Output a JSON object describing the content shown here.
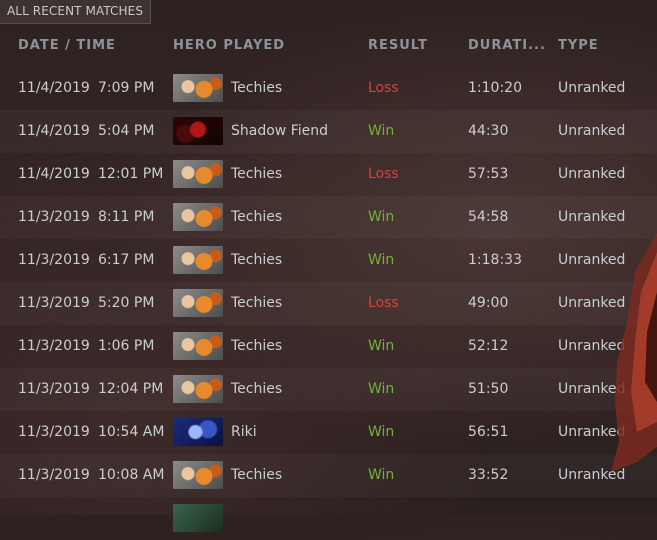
{
  "panel": {
    "title": "ALL RECENT MATCHES"
  },
  "columns": {
    "date_time": "DATE / TIME",
    "hero": "HERO PLAYED",
    "result": "RESULT",
    "duration": "DURATI...",
    "type": "TYPE"
  },
  "matches": [
    {
      "date": "11/4/2019",
      "time": "7:09 PM",
      "hero": "Techies",
      "hero_icon": "techies-portrait",
      "result": "Loss",
      "duration": "1:10:20",
      "type": "Unranked"
    },
    {
      "date": "11/4/2019",
      "time": "5:04 PM",
      "hero": "Shadow Fiend",
      "hero_icon": "shadow-fiend-portrait",
      "result": "Win",
      "duration": "44:30",
      "type": "Unranked"
    },
    {
      "date": "11/4/2019",
      "time": "12:01 PM",
      "hero": "Techies",
      "hero_icon": "techies-portrait",
      "result": "Loss",
      "duration": "57:53",
      "type": "Unranked"
    },
    {
      "date": "11/3/2019",
      "time": "8:11 PM",
      "hero": "Techies",
      "hero_icon": "techies-portrait",
      "result": "Win",
      "duration": "54:58",
      "type": "Unranked"
    },
    {
      "date": "11/3/2019",
      "time": "6:17 PM",
      "hero": "Techies",
      "hero_icon": "techies-portrait",
      "result": "Win",
      "duration": "1:18:33",
      "type": "Unranked"
    },
    {
      "date": "11/3/2019",
      "time": "5:20 PM",
      "hero": "Techies",
      "hero_icon": "techies-portrait",
      "result": "Loss",
      "duration": "49:00",
      "type": "Unranked"
    },
    {
      "date": "11/3/2019",
      "time": "1:06 PM",
      "hero": "Techies",
      "hero_icon": "techies-portrait",
      "result": "Win",
      "duration": "52:12",
      "type": "Unranked"
    },
    {
      "date": "11/3/2019",
      "time": "12:04 PM",
      "hero": "Techies",
      "hero_icon": "techies-portrait",
      "result": "Win",
      "duration": "51:50",
      "type": "Unranked"
    },
    {
      "date": "11/3/2019",
      "time": "10:54 AM",
      "hero": "Riki",
      "hero_icon": "riki-portrait",
      "result": "Win",
      "duration": "56:51",
      "type": "Unranked"
    },
    {
      "date": "11/3/2019",
      "time": "10:08 AM",
      "hero": "Techies",
      "hero_icon": "techies-portrait",
      "result": "Win",
      "duration": "33:52",
      "type": "Unranked"
    }
  ],
  "colors": {
    "win": "#71b33b",
    "loss": "#d5423a"
  }
}
